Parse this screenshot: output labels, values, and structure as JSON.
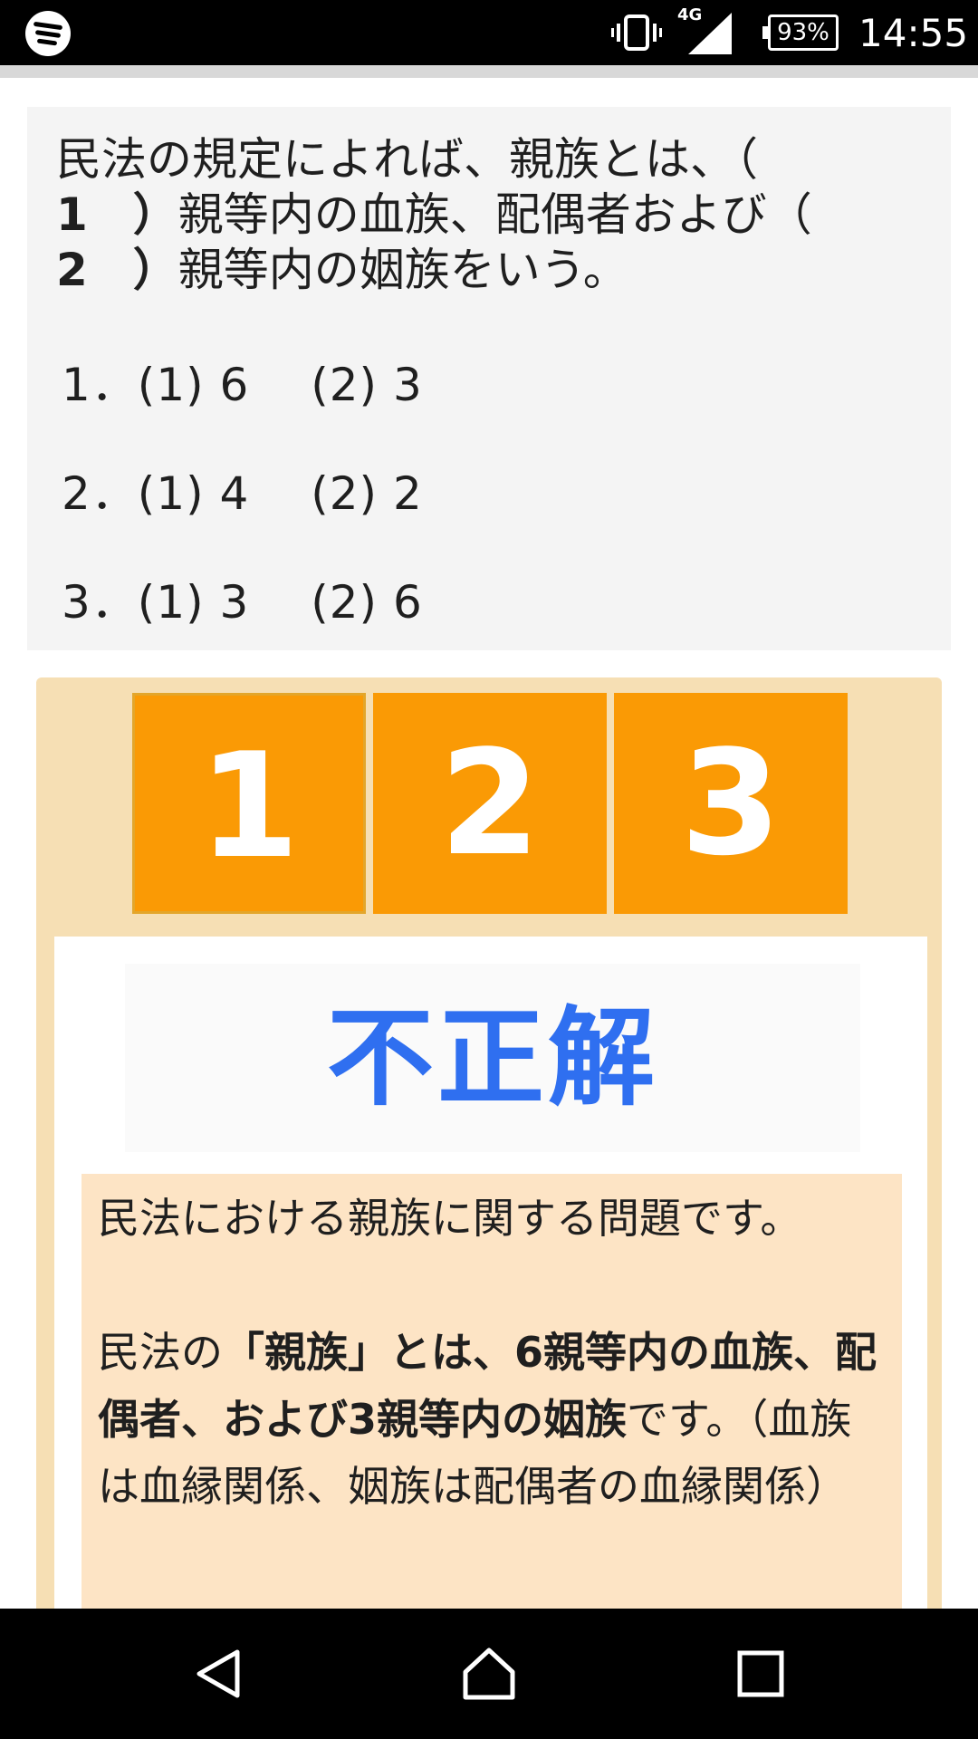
{
  "status_bar": {
    "network": "4G",
    "battery": "93%",
    "time": "14:55"
  },
  "question": {
    "text_1": "民法の規定によれば、親族とは、（",
    "blank_1": "1　）",
    "text_2": "親等内の血族、配偶者および（",
    "blank_2": "2　）",
    "text_3": "親等内の姻族をいう。",
    "choices": [
      "1．(1) 6　 (2) 3",
      "2．(1) 4　 (2) 2",
      "3．(1) 3　 (2) 6"
    ]
  },
  "answer_buttons": [
    "1",
    "2",
    "3"
  ],
  "result": {
    "label": "不正解",
    "explanation_intro": "民法における親族に関する問題です。",
    "explanation_p2_start": "民法の",
    "explanation_p2_bold": "「親族」とは、6親等内の血族、配偶者、および3親等内の姻族",
    "explanation_p2_end": "です。（血族は血縁関係、姻族は配偶者の血縁関係）"
  },
  "colors": {
    "answer_button": "#fa9a05",
    "panel": "#f6dfb4",
    "result_text": "#2f6ff0",
    "explanation_bg": "#fde4c5"
  },
  "icons": {
    "app": "spotify-icon",
    "vibrate": "vibrate-icon",
    "signal": "signal-icon",
    "battery": "battery-icon",
    "back": "back-icon",
    "home": "home-icon",
    "recents": "recents-icon"
  }
}
